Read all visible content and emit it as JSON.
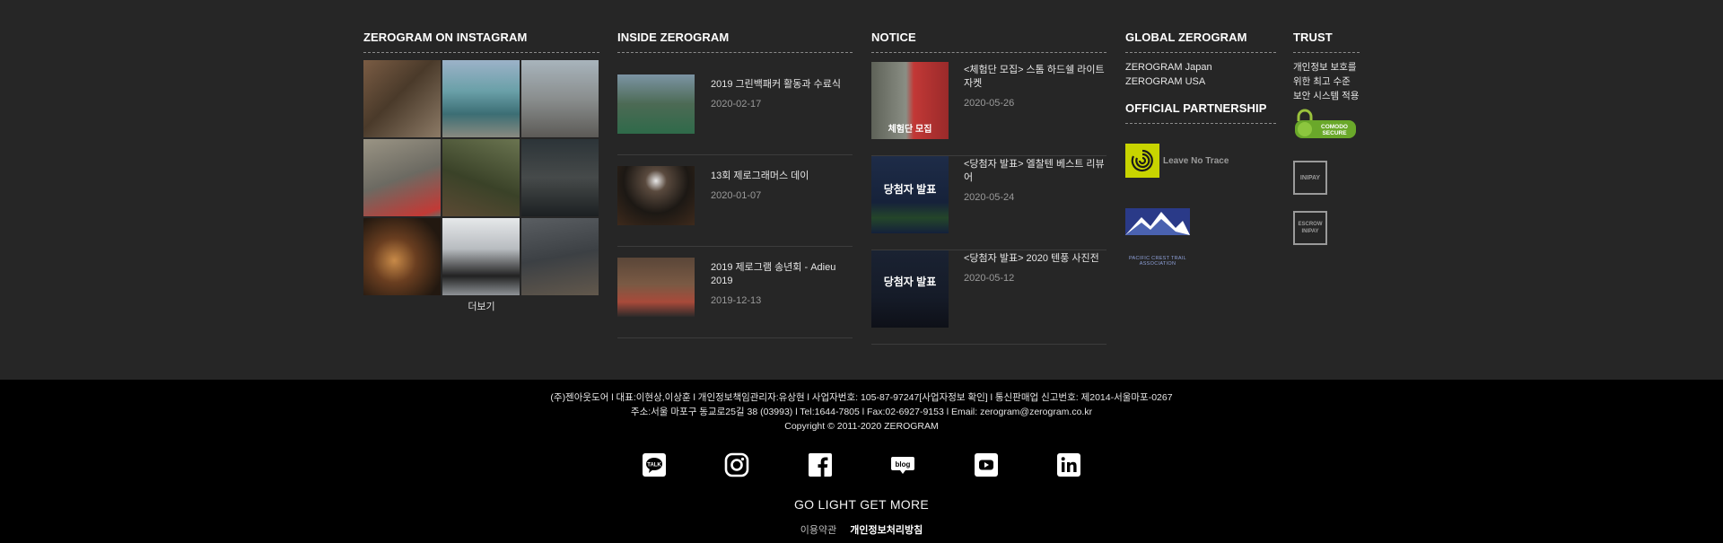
{
  "instagram": {
    "title": "ZEROGRAM ON INSTAGRAM",
    "more": "더보기",
    "photos": [
      {
        "icon": "forest-hikers-photo",
        "color": "#5a4a3c"
      },
      {
        "icon": "group-hikers-photo",
        "color": "#7d8aa0"
      },
      {
        "icon": "couple-walking-photo",
        "color": "#8b8f92"
      },
      {
        "icon": "legs-walking-photo",
        "color": "#6f6a62"
      },
      {
        "icon": "woods-photo",
        "color": "#3e4a30"
      },
      {
        "icon": "car-camping-photo",
        "color": "#2f3a3e"
      },
      {
        "icon": "tent-light-photo",
        "color": "#3a2a1a"
      },
      {
        "icon": "hiker-portrait-photo",
        "color": "#c4c8cc"
      },
      {
        "icon": "landscape-photo",
        "color": "#4a4e52"
      }
    ]
  },
  "inside": {
    "title": "INSIDE ZEROGRAM",
    "items": [
      {
        "title": "2019 그린백패커 활동과 수료식",
        "date": "2020-02-17",
        "color": "#3d6b52"
      },
      {
        "title": "13회 제로그래머스 데이",
        "date": "2020-01-07",
        "color": "#1d1a18"
      },
      {
        "title": "2019 제로그램 송년회 - Adieu 2019",
        "date": "2019-12-13",
        "color": "#6a3a2c"
      }
    ]
  },
  "notice": {
    "title": "NOTICE",
    "items": [
      {
        "title": "<체험단 모집> 스톰 하드쉘 라이트 자켓",
        "date": "2020-05-26",
        "badge": "체험단 모집",
        "color": "#7a8076"
      },
      {
        "title": "<당첨자 발표> 엘찰텐 베스트 리뷰어",
        "date": "2020-05-24",
        "badge": "당첨자 발표",
        "color": "#1a2a44"
      },
      {
        "title": "<당첨자 발표> 2020 텐풍 사진전",
        "date": "2020-05-12",
        "badge": "당첨자 발표",
        "color": "#1c2234"
      }
    ]
  },
  "global": {
    "title": "GLOBAL ZEROGRAM",
    "links": [
      "ZEROGRAM Japan",
      "ZEROGRAM USA"
    ],
    "partnership_title": "OFFICIAL PARTNERSHIP",
    "partners": [
      {
        "logo": "leave-no-trace-logo",
        "text": "Leave No Trace"
      },
      {
        "logo": "pacific-crest-trail-logo",
        "text": "PACIFIC CREST TRAIL ASSOCIATION"
      }
    ]
  },
  "trust": {
    "title": "TRUST",
    "text": "개인정보 보호를 위한 최고 수준 보안 시스템 적용",
    "badges": [
      "COMODO SECURE",
      "INIPAY",
      "ESCROW INIPAY"
    ]
  },
  "footer": {
    "line1": "(주)젠아웃도어 l 대표:이현상,이상훈 l 개인정보책임관리자:유상현 l 사업자번호: 105-87-97247[사업자정보 확인] l 통신판매업 신고번호: 제2014-서울마포-0267",
    "line2": "주소:서울 마포구 동교로25길 38 (03993) l Tel:1644-7805 l Fax:02-6927-9153 l Email: zerogram@zerogram.co.kr",
    "copyright": "Copyright © 2011-2020 ZEROGRAM",
    "slogan": "GO LIGHT GET MORE",
    "terms": "이용약관",
    "privacy": "개인정보처리방침",
    "social": [
      "kakaotalk-icon",
      "instagram-icon",
      "facebook-icon",
      "blog-icon",
      "youtube-icon",
      "linkedin-icon"
    ]
  }
}
